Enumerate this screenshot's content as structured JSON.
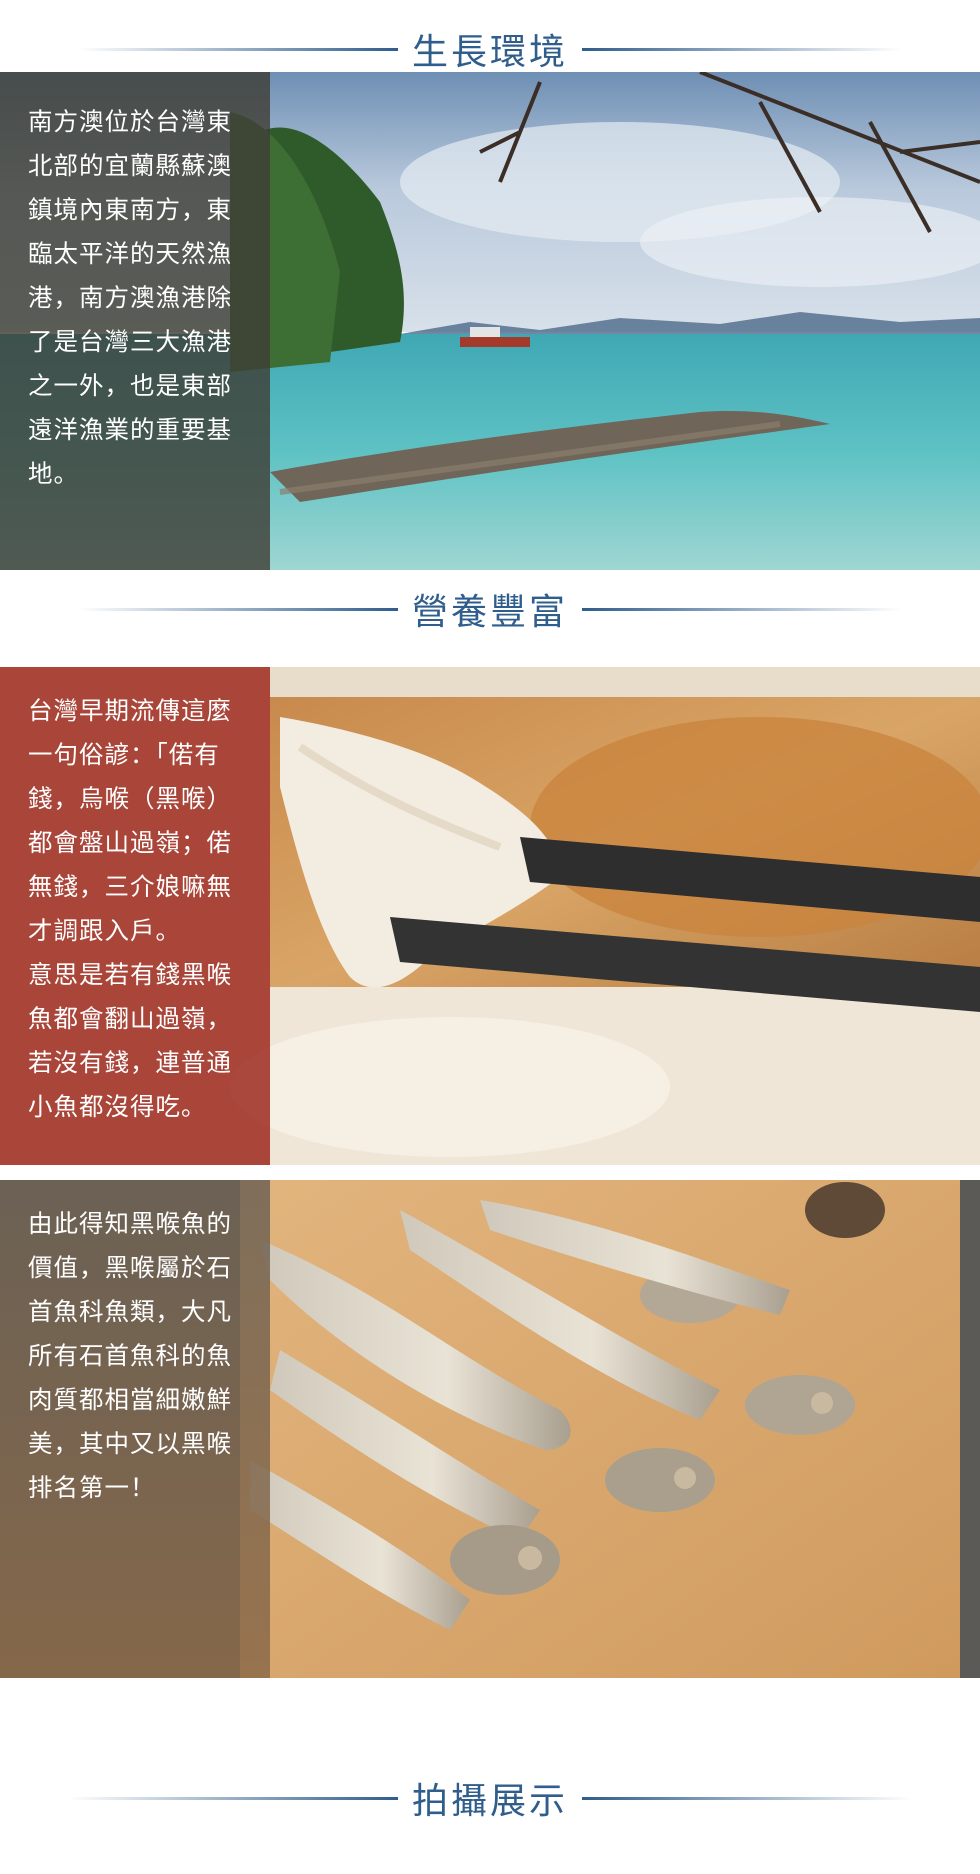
{
  "sections": {
    "environment": {
      "heading": "生長環境",
      "text": "南方澳位於台灣東北部的宜蘭縣蘇澳鎮境內東南方，東臨太平洋的天然漁港，南方澳漁港除了是台灣三大漁港之一外，也是東部遠洋漁業的重要基地。"
    },
    "nutrition": {
      "heading": "營養豐富",
      "paragraph1": "台灣早期流傳這麼一句俗諺：「偌有錢，烏喉（黑喉）都會盤山過嶺；偌無錢，三介娘嘛無才調跟入戶。",
      "paragraph2": "意思是若有錢黑喉魚都會翻山過嶺，若沒有錢，連普通小魚都沒得吃。"
    },
    "value": {
      "text": "由此得知黑喉魚的價值，黑喉屬於石首魚科魚類，大凡所有石首魚科的魚肉質都相當細嫩鮮美，其中又以黑喉排名第一！"
    },
    "showcase": {
      "heading": "拍攝展示"
    }
  },
  "colors": {
    "heading_text": "#2f5d8c",
    "panel_dark": "#4a4a42",
    "panel_red": "#a83a2c",
    "panel_wood": "#8c6a48"
  }
}
